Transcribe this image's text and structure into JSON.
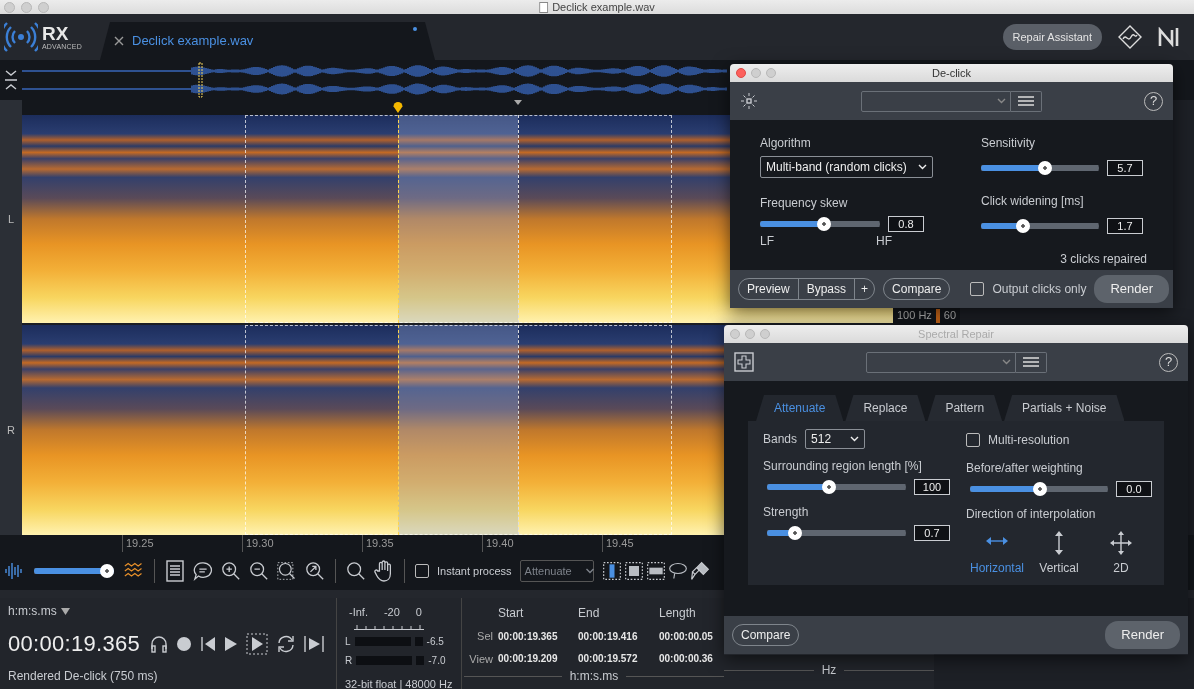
{
  "window": {
    "title": "Declick example.wav"
  },
  "header": {
    "logo": "RX",
    "logo_subtitle": "ADVANCED",
    "tab": {
      "label": "Declick example.wav",
      "unsaved": true
    },
    "repair_assistant": "Repair Assistant"
  },
  "spectrogram": {
    "channels": [
      "L",
      "R"
    ],
    "frequency_labels": [
      "100 Hz",
      "60"
    ],
    "time_ticks": [
      "19.25",
      "19.30",
      "19.35",
      "19.40",
      "19.45"
    ]
  },
  "toolbar": {
    "opacity_slider": {
      "level": 1
    },
    "instant_process": {
      "label": "Instant process",
      "checked": false
    },
    "mode": {
      "value": "Attenuate",
      "disabled": true
    },
    "tools": [
      {
        "kind": "time",
        "selected": true
      },
      {
        "kind": "rectangle",
        "selected": false
      },
      {
        "kind": "frequency",
        "selected": false
      },
      {
        "kind": "lasso",
        "selected": false
      },
      {
        "kind": "brush",
        "selected": false
      }
    ]
  },
  "transport": {
    "time_format": "h:m:s.ms",
    "time": "00:00:19.365",
    "status": "Rendered De-click (750 ms)"
  },
  "meter": {
    "scale": [
      "-Inf.",
      "-20",
      "0"
    ],
    "channels": [
      {
        "name": "L",
        "reading": "-6.5"
      },
      {
        "name": "R",
        "reading": "-7.0"
      }
    ],
    "format": "32-bit float | 48000 Hz"
  },
  "selection": {
    "columns": [
      "Start",
      "End",
      "Length"
    ],
    "rows": [
      {
        "label": "Sel",
        "values": [
          "00:00:19.365",
          "00:00:19.416",
          "00:00:00.05"
        ]
      },
      {
        "label": "View",
        "values": [
          "00:00:19.209",
          "00:00:19.572",
          "00:00:00.36"
        ]
      }
    ],
    "unit": "h:m:s.ms"
  },
  "frequency_panel": {
    "unit": "Hz"
  },
  "declick": {
    "title": "De-click",
    "active": true,
    "help": "?",
    "algorithm": {
      "label": "Algorithm",
      "value": "Multi-band (random clicks)"
    },
    "frequency_skew": {
      "label": "Frequency skew",
      "level": 0.54,
      "value": "0.8",
      "min_label": "LF",
      "max_label": "HF"
    },
    "sensitivity": {
      "label": "Sensitivity",
      "level": 0.55,
      "value": "5.7"
    },
    "click_widening": {
      "label": "Click widening [ms]",
      "level": 0.34,
      "value": "1.7"
    },
    "result": "3 clicks repaired",
    "preview": "Preview",
    "bypass": "Bypass",
    "add": "+",
    "compare": "Compare",
    "output_clicks_only": {
      "label": "Output clicks only",
      "checked": false
    },
    "render": "Render"
  },
  "spectral_repair": {
    "title": "Spectral Repair",
    "active": false,
    "help": "?",
    "tabs": [
      {
        "label": "Attenuate",
        "selected": true
      },
      {
        "label": "Replace",
        "selected": false
      },
      {
        "label": "Pattern",
        "selected": false
      },
      {
        "label": "Partials + Noise",
        "selected": false
      }
    ],
    "bands": {
      "label": "Bands",
      "value": "512"
    },
    "multi_resolution": {
      "label": "Multi-resolution",
      "checked": false
    },
    "surrounding": {
      "label": "Surrounding region length [%]",
      "level": 0.44,
      "value": "100"
    },
    "weighting": {
      "label": "Before/after weighting",
      "level": 0.51,
      "value": "0.0"
    },
    "strength": {
      "label": "Strength",
      "level": 0.17,
      "value": "0.7"
    },
    "direction": {
      "label": "Direction of interpolation",
      "options": [
        {
          "kind": "horizontal",
          "label": "Horizontal",
          "selected": true
        },
        {
          "kind": "vertical",
          "label": "Vertical",
          "selected": false
        },
        {
          "kind": "both",
          "label": "2D",
          "selected": false
        }
      ]
    },
    "compare": "Compare",
    "render": "Render"
  }
}
